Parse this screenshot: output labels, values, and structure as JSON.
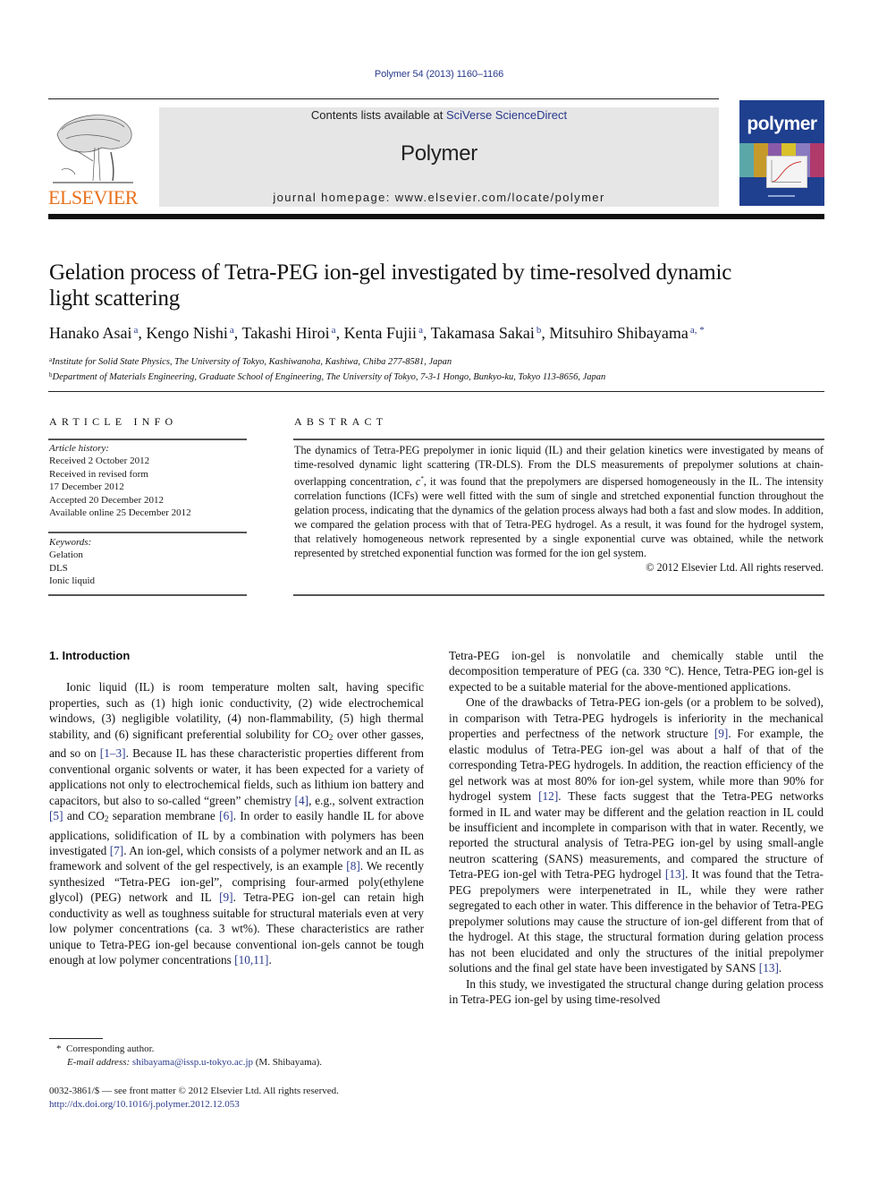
{
  "header": {
    "journal_ref": "Polymer 54 (2013) 1160–1166",
    "contents_prefix": "Contents lists available at ",
    "contents_link": "SciVerse ScienceDirect",
    "journal_name": "Polymer",
    "homepage": "journal homepage: www.elsevier.com/locate/polymer",
    "publisher_logo_text": "ELSEVIER",
    "cover_title": "polymer",
    "colors": {
      "link": "#2a3a8c",
      "elsevier_orange": "#e9711c",
      "cover_blue": "#1f3f8f",
      "header_box": "#e6e6e6"
    }
  },
  "article": {
    "title": "Gelation process of Tetra-PEG ion-gel investigated by time-resolved dynamic light scattering",
    "authors": [
      {
        "name": "Hanako Asai",
        "aff": "a"
      },
      {
        "name": "Kengo Nishi",
        "aff": "a"
      },
      {
        "name": "Takashi Hiroi",
        "aff": "a"
      },
      {
        "name": "Kenta Fujii",
        "aff": "a"
      },
      {
        "name": "Takamasa Sakai",
        "aff": "b"
      },
      {
        "name": "Mitsuhiro Shibayama",
        "aff": "a, *"
      }
    ],
    "affiliations": [
      {
        "mark": "a",
        "text": "Institute for Solid State Physics, The University of Tokyo, Kashiwanoha, Kashiwa, Chiba 277-8581, Japan"
      },
      {
        "mark": "b",
        "text": "Department of Materials Engineering, Graduate School of Engineering, The University of Tokyo, 7-3-1 Hongo, Bunkyo-ku, Tokyo 113-8656, Japan"
      }
    ]
  },
  "article_info": {
    "label": "ARTICLE INFO",
    "history_label": "Article history:",
    "history": [
      "Received 2 October 2012",
      "Received in revised form",
      "17 December 2012",
      "Accepted 20 December 2012",
      "Available online 25 December 2012"
    ],
    "keywords_label": "Keywords:",
    "keywords": [
      "Gelation",
      "DLS",
      "Ionic liquid"
    ]
  },
  "abstract": {
    "label": "ABSTRACT",
    "text_1": "The dynamics of Tetra-PEG prepolymer in ionic liquid (IL) and their gelation kinetics were investigated by means of time-resolved dynamic light scattering (TR-DLS). From the DLS measurements of prepolymer solutions at chain-overlapping concentration, ",
    "c_star": "c",
    "c_star_sup": "*",
    "text_2": ", it was found that the prepolymers are dispersed homogeneously in the IL. The intensity correlation functions (ICFs) were well fitted with the sum of single and stretched exponential function throughout the gelation process, indicating that the dynamics of the gelation process always had both a fast and slow modes. In addition, we compared the gelation process with that of Tetra-PEG hydrogel. As a result, it was found for the hydrogel system, that relatively homogeneous network represented by a single exponential curve was obtained, while the network represented by stretched exponential function was formed for the ion gel system.",
    "copyright": "© 2012 Elsevier Ltd. All rights reserved."
  },
  "body": {
    "section_heading": "1.  Introduction",
    "p1": [
      {
        "t": "Ionic liquid (IL) is room temperature molten salt, having specific properties, such as (1) high ionic conductivity, (2) wide electrochemical windows, (3) negligible volatility, (4) non-flammability, (5) high thermal stability, and (6) significant preferential solubility for CO"
      },
      {
        "sub": "2"
      },
      {
        "t": " over other gasses, and so on "
      },
      {
        "ref": "[1–3]"
      },
      {
        "t": ". Because IL has these characteristic properties different from conventional organic solvents or water, it has been expected for a variety of applications not only to electrochemical fields, such as lithium ion battery and capacitors, but also to so-called “green” chemistry "
      },
      {
        "ref": "[4]"
      },
      {
        "t": ", e.g., solvent extraction "
      },
      {
        "ref": "[5]"
      },
      {
        "t": " and CO"
      },
      {
        "sub": "2"
      },
      {
        "t": " separation membrane "
      },
      {
        "ref": "[6]"
      },
      {
        "t": ". In order to easily handle IL for above applications, solidification of IL by a combination with polymers has been investigated "
      },
      {
        "ref": "[7]"
      },
      {
        "t": ". An ion-gel, which consists of a polymer network and an IL as framework and solvent of the gel respectively, is an example "
      },
      {
        "ref": "[8]"
      },
      {
        "t": ". We recently synthesized “Tetra-PEG ion-gel”, comprising four-armed poly(ethylene glycol) (PEG) network and IL "
      },
      {
        "ref": "[9]"
      },
      {
        "t": ". Tetra-PEG ion-gel can retain high conductivity as well as toughness suitable for structural materials even at very low polymer concentrations (ca. 3 wt%). These characteristics are rather unique to Tetra-PEG ion-gel because conventional ion-gels cannot be tough enough at low polymer concentrations "
      },
      {
        "ref": "[10,11]"
      },
      {
        "t": "."
      }
    ],
    "p1_cont": "Tetra-PEG ion-gel is nonvolatile and chemically stable until the decomposition temperature of PEG (ca. 330 °C). Hence, Tetra-PEG ion-gel is expected to be a suitable material for the above-mentioned applications.",
    "p2": [
      {
        "t": "One of the drawbacks of Tetra-PEG ion-gels (or a problem to be solved), in comparison with Tetra-PEG hydrogels is inferiority in the mechanical properties and perfectness of the network structure "
      },
      {
        "ref": "[9]"
      },
      {
        "t": ". For example, the elastic modulus of Tetra-PEG ion-gel was about a half of that of the corresponding Tetra-PEG hydrogels. In addition, the reaction efficiency of the gel network was at most 80% for ion-gel system, while more than 90% for hydrogel system "
      },
      {
        "ref": "[12]"
      },
      {
        "t": ". These facts suggest that the Tetra-PEG networks formed in IL and water may be different and the gelation reaction in IL could be insufficient and incomplete in comparison with that in water. Recently, we reported the structural analysis of Tetra-PEG ion-gel by using small-angle neutron scattering (SANS) measurements, and compared the structure of Tetra-PEG ion-gel with Tetra-PEG hydrogel "
      },
      {
        "ref": "[13]"
      },
      {
        "t": ". It was found that the Tetra-PEG prepolymers were interpenetrated in IL, while they were rather segregated to each other in water. This difference in the behavior of Tetra-PEG prepolymer solutions may cause the structure of ion-gel different from that of the hydrogel. At this stage, the structural formation during gelation process has not been elucidated and only the structures of the initial prepolymer solutions and the final gel state have been investigated by SANS "
      },
      {
        "ref": "[13]"
      },
      {
        "t": "."
      }
    ],
    "p3": "In this study, we investigated the structural change during gelation process in Tetra-PEG ion-gel by using time-resolved"
  },
  "footnotes": {
    "corresponding_mark": "*",
    "corresponding": "Corresponding author.",
    "email_label": "E-mail address:",
    "email": "shibayama@issp.u-tokyo.ac.jp",
    "email_owner": "(M. Shibayama).",
    "issn_line": "0032-3861/$ — see front matter © 2012 Elsevier Ltd. All rights reserved.",
    "doi": "http://dx.doi.org/10.1016/j.polymer.2012.12.053"
  }
}
